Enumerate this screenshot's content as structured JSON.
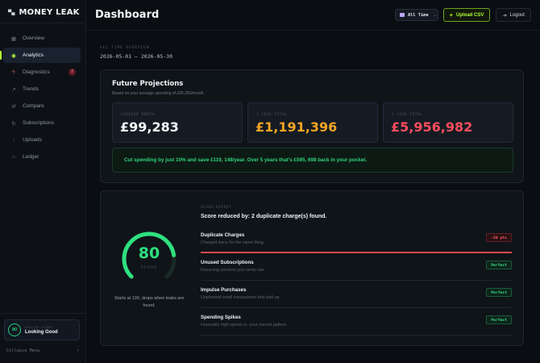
{
  "app": {
    "brand_icon": "pixel-logo-icon",
    "brand_name": "MONEY LEAK"
  },
  "sidebar": {
    "items": [
      {
        "label": "Overview",
        "icon": "grid-icon"
      },
      {
        "label": "Analytics",
        "icon": "target-icon",
        "active": true
      },
      {
        "label": "Diagnostics",
        "icon": "bolt-icon",
        "badge": "2"
      },
      {
        "label": "Trends",
        "icon": "trend-icon"
      },
      {
        "label": "Compare",
        "icon": "compare-icon"
      },
      {
        "label": "Subscriptions",
        "icon": "refresh-icon"
      },
      {
        "label": "Uploads",
        "icon": "upload-icon"
      },
      {
        "label": "Ledger",
        "icon": "bank-icon"
      }
    ],
    "score_card": {
      "value": "80",
      "caption": "HEALTH SCORE",
      "status": "Looking Good"
    },
    "collapse_label": "Collapse Menu"
  },
  "header": {
    "title": "Dashboard",
    "range_select": "All Time",
    "upload_label": "Upload CSV",
    "logout_label": "Logout"
  },
  "overview": {
    "caption": "ALL TIME OVERVIEW",
    "range": "2026-05-01 — 2026-05-30"
  },
  "projections": {
    "title": "Future Projections",
    "subtitle": "Based on your average spending of £99,283/month",
    "stats": [
      {
        "caption": "AVERAGE MONTH",
        "value": "£99,283",
        "color": "#f4f6f9"
      },
      {
        "caption": "1 YEAR TOTAL",
        "value": "£1,191,396",
        "color": "#f5a524"
      },
      {
        "caption": "5 YEAR TOTAL",
        "value": "£5,956,982",
        "color": "#ff4d5e"
      }
    ],
    "tip": "Cut spending by just 10% and save £119, 148/year. Over 5 years that's £595, 698 back in your pocket."
  },
  "score": {
    "value": "80",
    "value_fraction": 0.8,
    "caption": "SCORE",
    "note": "Starts at 100, drops when leaks are found.",
    "report_caption": "SCORE REPORT",
    "report_headline": "Score reduced by: 2 duplicate charge(s) found.",
    "checks": [
      {
        "title": "Duplicate Charges",
        "sub": "Charged twice for the same thing.",
        "badge": "-20 pts",
        "status": "bad"
      },
      {
        "title": "Unused Subscriptions",
        "sub": "Recurring services you rarely use.",
        "badge": "Perfect",
        "status": "good"
      },
      {
        "title": "Impulse Purchases",
        "sub": "Unplanned small transactions that add up.",
        "badge": "Perfect",
        "status": "good"
      },
      {
        "title": "Spending Spikes",
        "sub": "Unusually high spend vs. your normal pattern.",
        "badge": "Perfect",
        "status": "good"
      }
    ],
    "colors": {
      "good": "#2ee07f",
      "bad": "#e5484d",
      "track": "#1a2a24"
    }
  }
}
